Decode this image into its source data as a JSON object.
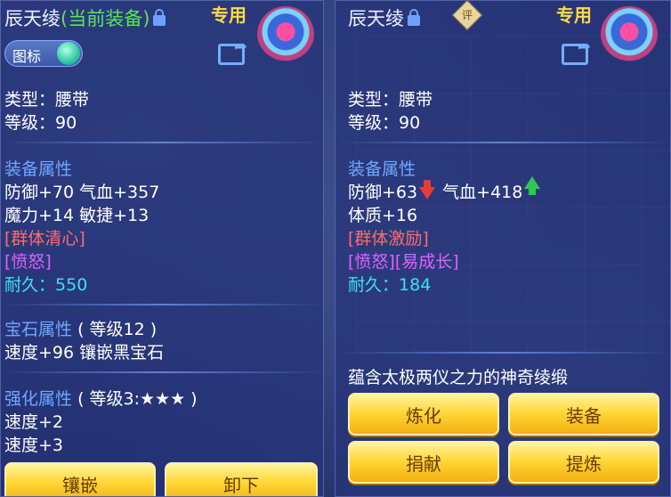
{
  "left": {
    "title": "辰天绫",
    "current_tag": "(当前装备)",
    "special": "专用",
    "toggle_label": "图标",
    "type": "类型：腰带",
    "level": "等级：90",
    "attr_header": "装备属性",
    "attr_line1": "防御+70 气血+357",
    "attr_line2": "魔力+14 敏捷+13",
    "special_skill": "[群体清心]",
    "special_effect": "[愤怒]",
    "durability_label": "耐久：",
    "durability_value": "550",
    "gem_header": "宝石属性",
    "gem_level": "( 等级12 )",
    "gem_line": "速度+96 镶嵌黑宝石",
    "enhance_header": "强化属性",
    "enhance_level": "( 等级3:★★★ )",
    "enhance_line1": "速度+2",
    "enhance_line2": "速度+3",
    "btn_inlay": "镶嵌",
    "btn_unequip": "卸下"
  },
  "right": {
    "title": "辰天绫",
    "special": "专用",
    "review_icon": "评",
    "type": "类型：腰带",
    "level": "等级：90",
    "attr_header": "装备属性",
    "attr_def": "防御+63",
    "attr_hp": "气血+418",
    "attr_line2": "体质+16",
    "special_skill": "[群体激励]",
    "special_effect": "[愤怒][易成长]",
    "durability_label": "耐久：",
    "durability_value": "184",
    "description": "蕴含太极两仪之力的神奇绫缎",
    "btn_refine": "炼化",
    "btn_equip": "装备",
    "btn_donate": "捐献",
    "btn_extract": "提炼"
  },
  "colors": {
    "green": "#5be35b",
    "header_blue": "#6fa8ff",
    "red": "#ff6a6a",
    "purple": "#e060ff",
    "cyan": "#3ee0f0",
    "gold": "#ffd84a"
  }
}
